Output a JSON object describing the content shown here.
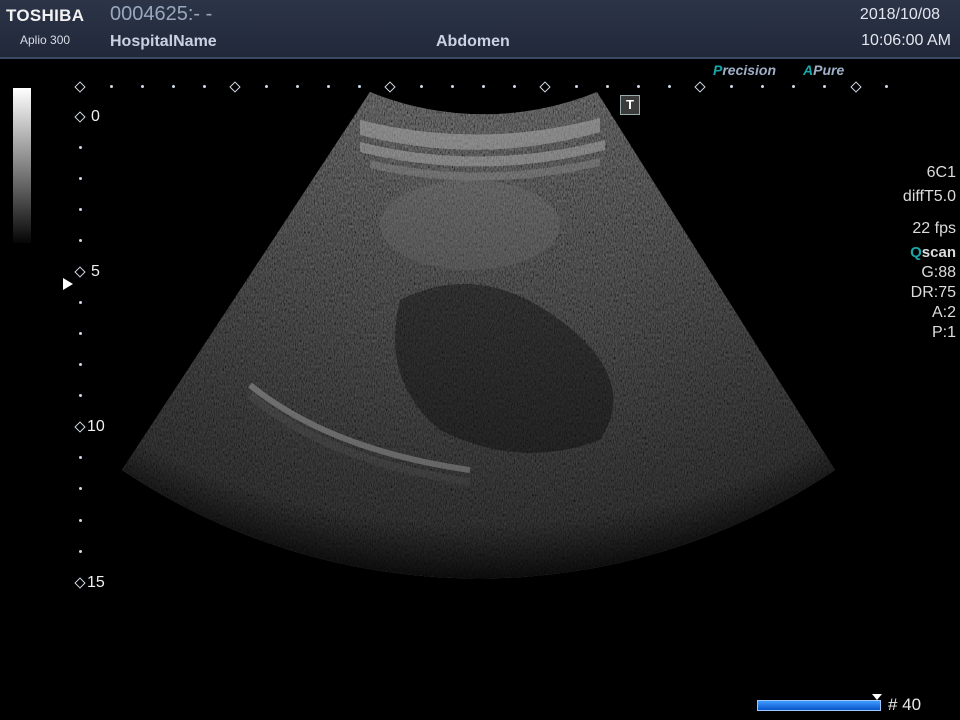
{
  "header": {
    "brand": "TOSHIBA",
    "model": "Aplio 300",
    "patient_id": "0004625:- -",
    "hospital": "HospitalName",
    "preset": "Abdomen",
    "date": "2018/10/08",
    "time": "10:06:00 AM"
  },
  "modes": {
    "precision_letter": "P",
    "precision_rest": "recision",
    "apure_letter": "A",
    "apure_rest": "Pure"
  },
  "depth_scale": {
    "labels": [
      "0",
      "5",
      "10",
      "15"
    ]
  },
  "t_marker": "T",
  "params": {
    "probe": "6C1",
    "harmonic": "diffT5.0",
    "fps": "22 fps",
    "qscan_q": "Q",
    "qscan_rest": "scan",
    "gain": "G:88",
    "dynamic_range": "DR:75",
    "a": "A:2",
    "p": "P:1"
  },
  "cine": {
    "frame": "# 40"
  },
  "colors": {
    "header_bg": "#27304a",
    "accent_teal": "#19a6a8",
    "cine_bar": "#1f78e6"
  }
}
